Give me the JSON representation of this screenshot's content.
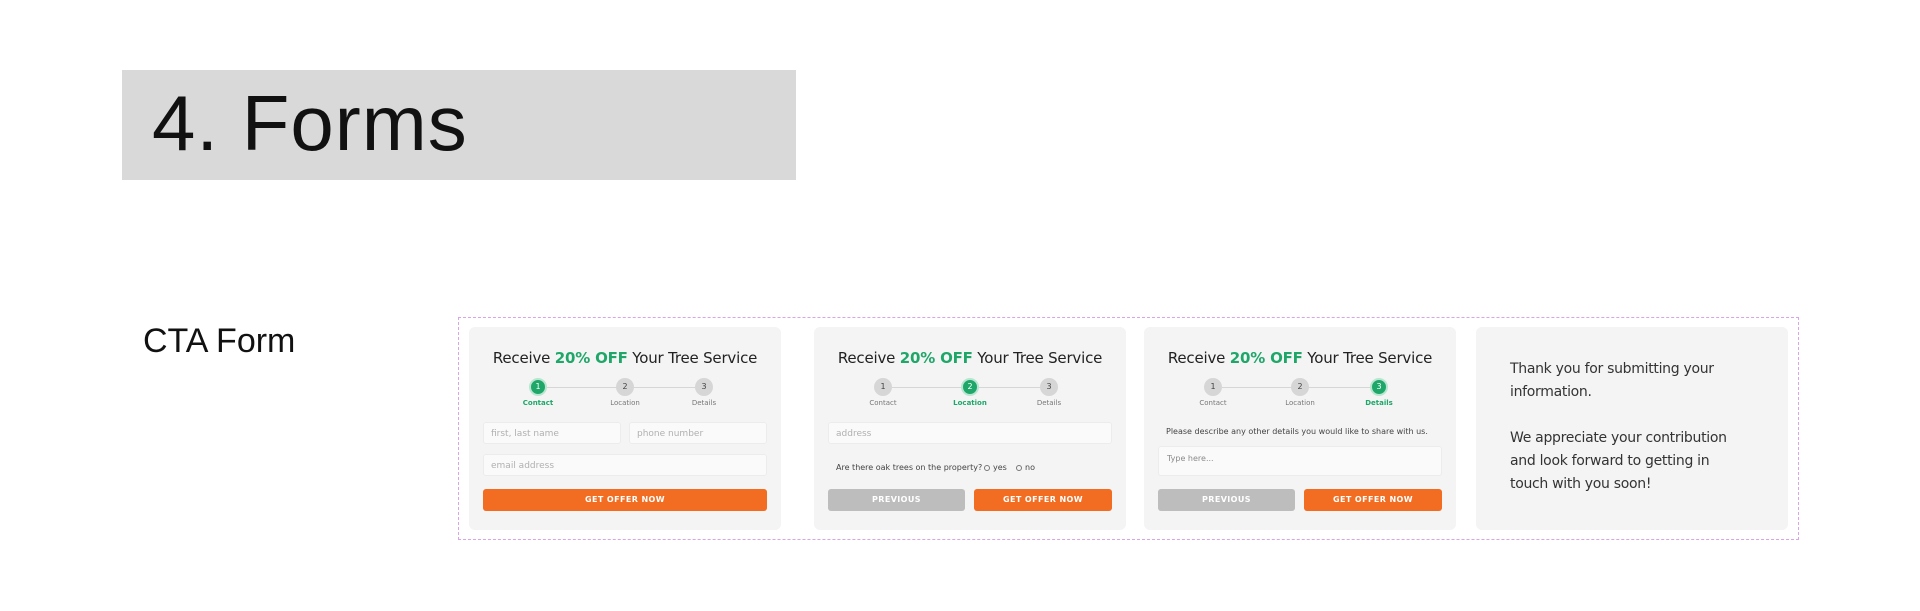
{
  "header": {
    "title": "4. Forms"
  },
  "section_label": "CTA Form",
  "card_title": {
    "prefix": "Receive ",
    "highlight": "20% OFF",
    "suffix": " Your Tree Service"
  },
  "steps": [
    "Contact",
    "Location",
    "Details"
  ],
  "step_numbers": [
    "1",
    "2",
    "3"
  ],
  "card1": {
    "name_placeholder": "first, last name",
    "phone_placeholder": "phone number",
    "email_placeholder": "email address",
    "submit_label": "GET OFFER NOW"
  },
  "card2": {
    "address_placeholder": "address",
    "question": "Are there oak trees on the property?",
    "options": [
      "yes",
      "no"
    ],
    "previous_label": "PREVIOUS",
    "submit_label": "GET OFFER NOW"
  },
  "card3": {
    "prompt": "Please describe any other details you would like to share with us.",
    "textarea_placeholder": "Type here...",
    "previous_label": "PREVIOUS",
    "submit_label": "GET OFFER NOW"
  },
  "card4": {
    "message_1": "Thank you for submitting your information.",
    "message_2": "We appreciate your contribution and look forward to getting in touch with you soon!"
  },
  "colors": {
    "accent_green": "#1fa76a",
    "accent_orange": "#f26d21",
    "frame_dashed": "#d9a5e6"
  }
}
